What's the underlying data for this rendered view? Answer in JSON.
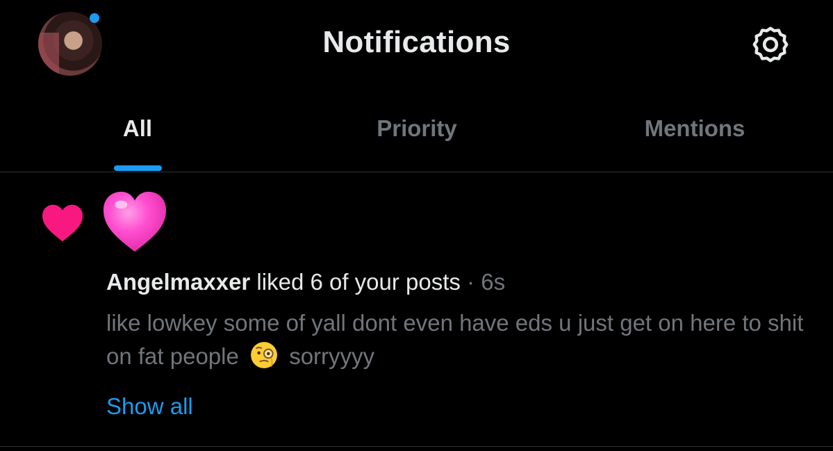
{
  "header": {
    "title": "Notifications",
    "avatar_icon": "profile-avatar",
    "settings_icon": "gear-icon",
    "unread_dot_color": "#1d9bf0"
  },
  "tabs": [
    {
      "label": "All",
      "active": true
    },
    {
      "label": "Priority",
      "active": false
    },
    {
      "label": "Mentions",
      "active": false
    }
  ],
  "notification": {
    "type_icon": "heart-icon",
    "type_icon_color": "#f91880",
    "liker_avatar_icon": "pink-heart-avatar",
    "user": "Angelmaxxer",
    "action": " liked 6 of your posts",
    "separator": " · ",
    "time": "6s",
    "body_before_emoji": "like lowkey some of yall dont even have eds u just get on here to shit on fat people",
    "emoji": "face-with-monocle-icon",
    "body_after_emoji": "sorryyyy",
    "show_all_label": "Show all"
  },
  "colors": {
    "background": "#000000",
    "primary_text": "#e7e9ea",
    "secondary_text": "#71767b",
    "accent": "#1d9bf0",
    "divider": "#2f3336"
  }
}
